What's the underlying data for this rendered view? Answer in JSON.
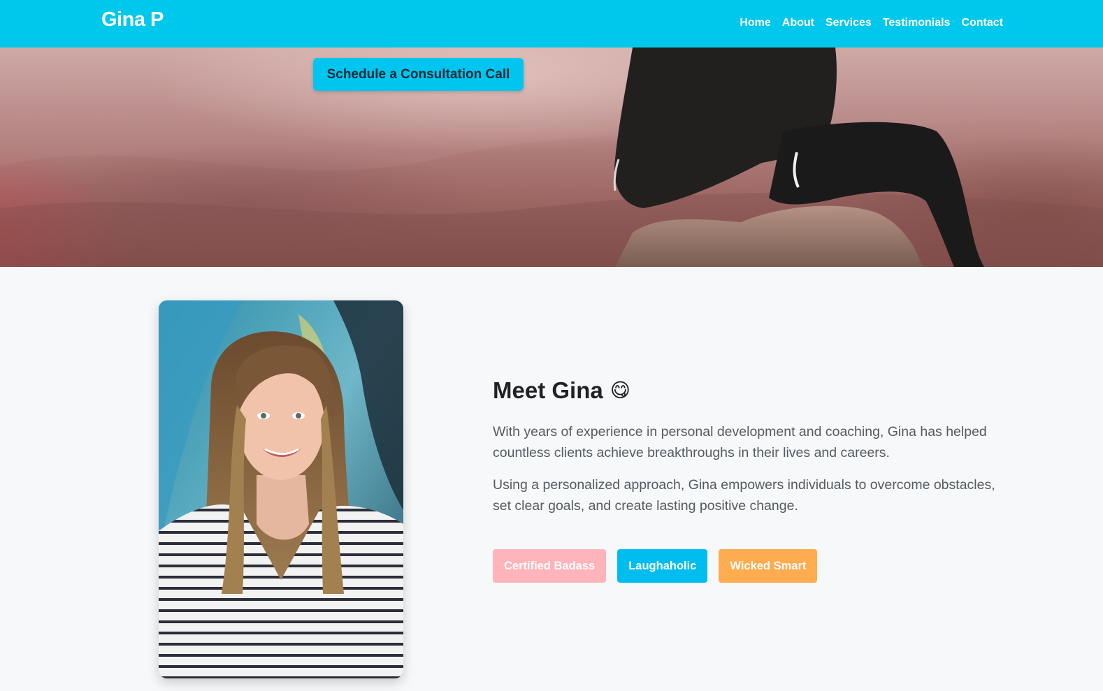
{
  "navbar": {
    "brand": "Gina P",
    "links": [
      "Home",
      "About",
      "Services",
      "Testimonials",
      "Contact"
    ]
  },
  "hero": {
    "cta_label": "Schedule a Consultation Call"
  },
  "about": {
    "title": "Meet Gina",
    "emoji": "😋",
    "paragraphs": [
      "With years of experience in personal development and coaching, Gina has helped countless clients achieve breakthroughs in their lives and careers.",
      "Using a personalized approach, Gina empowers individuals to overcome obstacles, set clear goals, and create lasting positive change."
    ],
    "tags": [
      {
        "label": "Certified Badass",
        "color": "#ffb3ba"
      },
      {
        "label": "Laughaholic",
        "color": "#00bdf0"
      },
      {
        "label": "Wicked Smart",
        "color": "#ffab4f"
      }
    ]
  },
  "colors": {
    "accent": "#00c8ec",
    "page_bg": "#f6f8f9"
  }
}
